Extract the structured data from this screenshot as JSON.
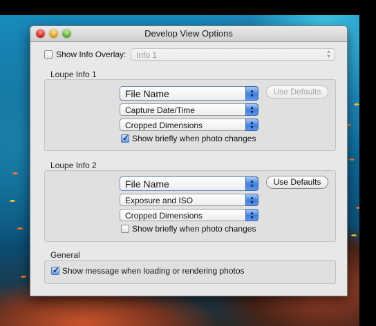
{
  "window": {
    "title": "Develop View Options"
  },
  "overlay": {
    "checkbox_label": "Show Info Overlay:",
    "checked": false,
    "select_value": "Info 1"
  },
  "loupe1": {
    "title": "Loupe Info 1",
    "field1": "File Name",
    "field2": "Capture Date/Time",
    "field3": "Cropped Dimensions",
    "defaults_button": "Use Defaults",
    "show_briefly_label": "Show briefly when photo changes",
    "show_briefly_checked": true
  },
  "loupe2": {
    "title": "Loupe Info 2",
    "field1": "File Name",
    "field2": "Exposure and ISO",
    "field3": "Cropped Dimensions",
    "defaults_button": "Use Defaults",
    "show_briefly_label": "Show briefly when photo changes",
    "show_briefly_checked": false
  },
  "general": {
    "title": "General",
    "message_label": "Show message when loading or rendering photos",
    "message_checked": true
  },
  "icons": {
    "check": "checkmark-icon",
    "arrows": "up-down-arrows-icon"
  }
}
